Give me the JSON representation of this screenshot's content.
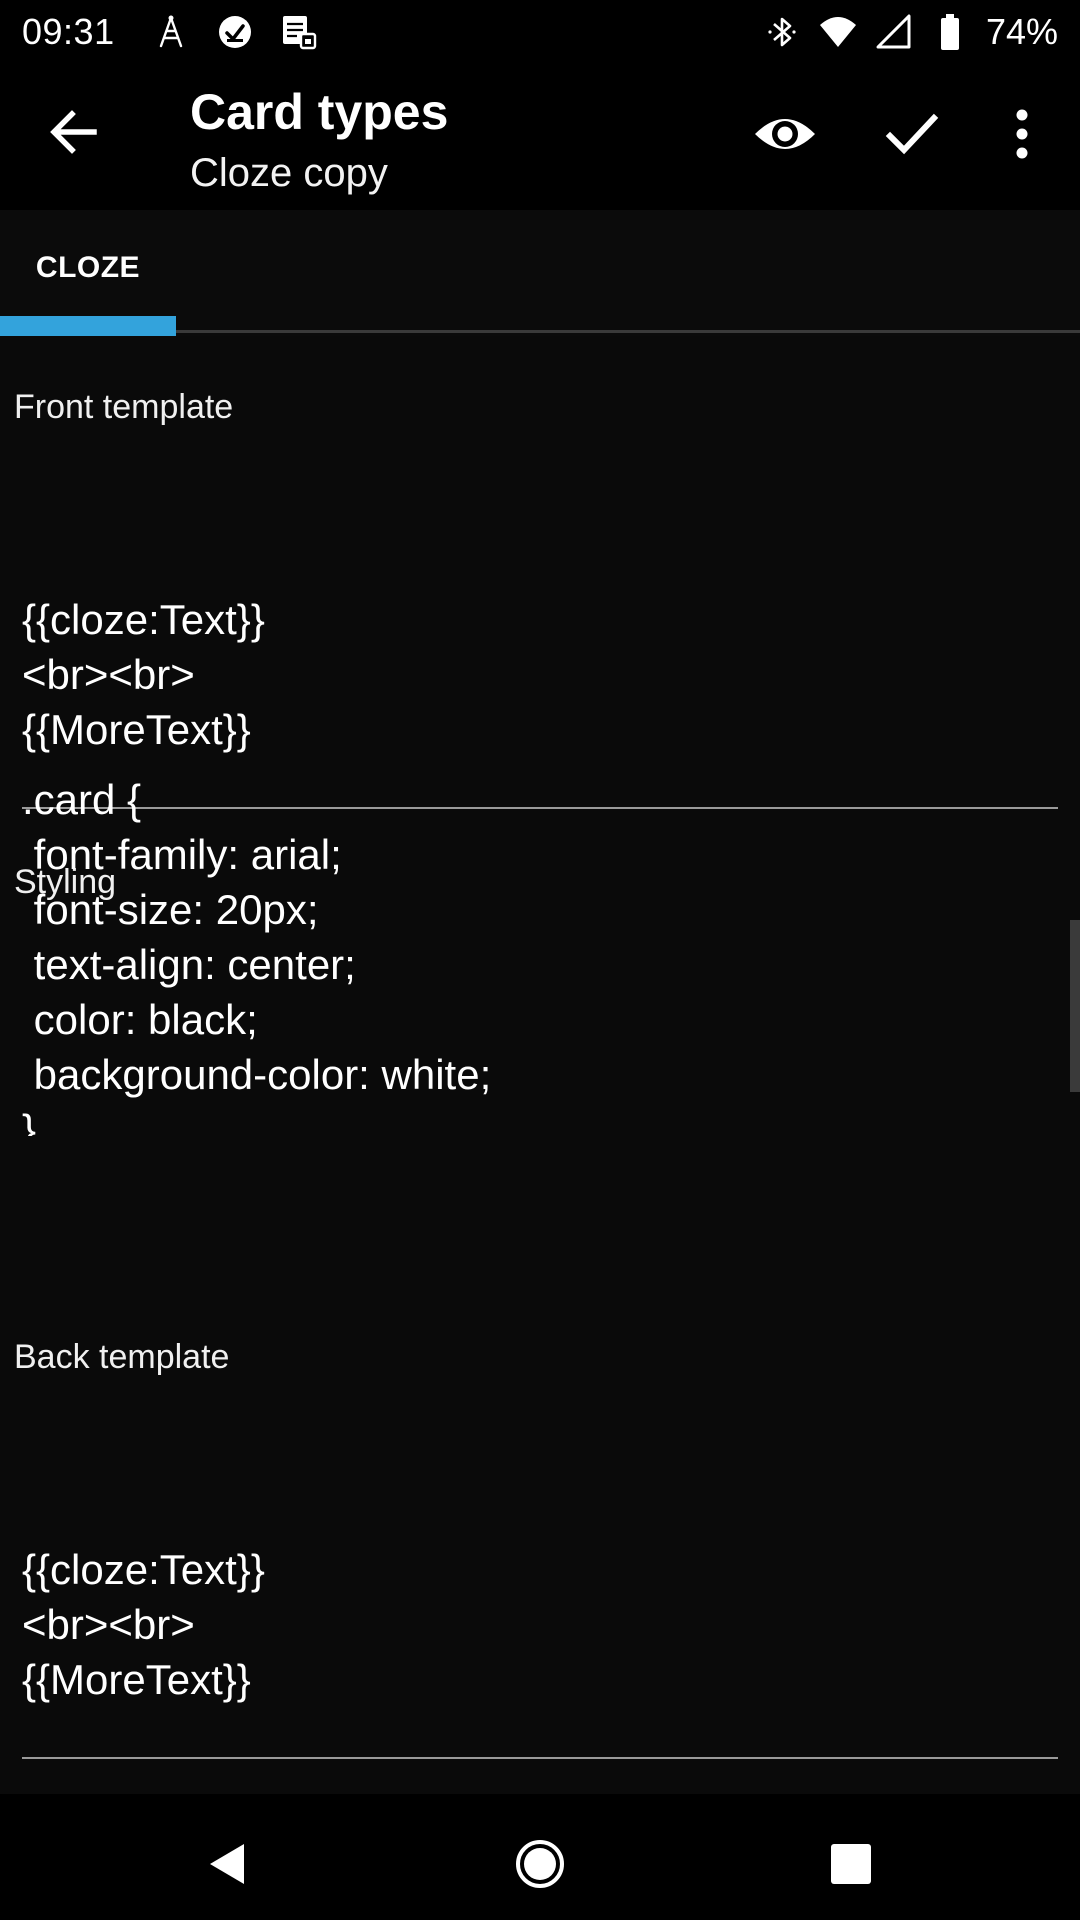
{
  "status_bar": {
    "time": "09:31",
    "battery_percent": "74%",
    "left_icons": [
      "signal-tower-icon",
      "checkmark-circle-icon",
      "notes-sync-icon"
    ],
    "right_icons": [
      "bluetooth-icon",
      "wifi-icon",
      "cell-signal-icon",
      "battery-icon"
    ]
  },
  "app_bar": {
    "title": "Card types",
    "subtitle": "Cloze copy",
    "actions": [
      "preview-eye-icon",
      "confirm-check-icon",
      "more-vert-icon"
    ]
  },
  "tabs": [
    {
      "label": "CLOZE",
      "selected": true
    }
  ],
  "accent_color": "#33a3dc",
  "sections": {
    "front_template": {
      "label": "Front template",
      "content": "\n\n{{cloze:Text}}\n<br><br>\n{{MoreText}}\n"
    },
    "styling": {
      "label": "Styling",
      "content": ".card {\n font-family: arial;\n font-size: 20px;\n text-align: center;\n color: black;\n background-color: white;\n}"
    },
    "back_template": {
      "label": "Back template",
      "content": "\n\n{{cloze:Text}}\n<br><br>\n{{MoreText}}\n"
    }
  },
  "nav_bar": {
    "buttons": [
      "nav-back-icon",
      "nav-home-icon",
      "nav-recents-icon"
    ]
  }
}
